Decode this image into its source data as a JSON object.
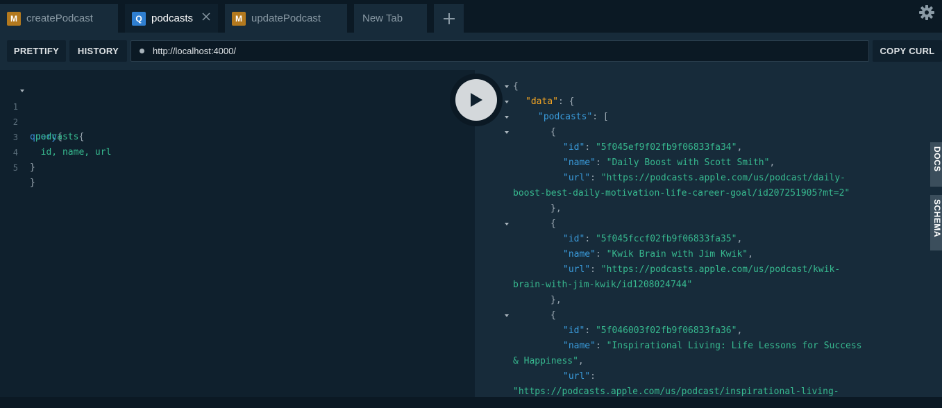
{
  "tabs": [
    {
      "badge": "M",
      "badge_color": "#b3791e",
      "label": "createPodcast"
    },
    {
      "badge": "Q",
      "badge_color": "#2f7fd1",
      "label": "podcasts",
      "active": true
    },
    {
      "badge": "M",
      "badge_color": "#b3791e",
      "label": "updatePodcast"
    },
    {
      "badge": "",
      "label": "New Tab"
    }
  ],
  "toolbar": {
    "prettify_label": "PRETTIFY",
    "history_label": "HISTORY",
    "url": "http://localhost:4000/",
    "copy_curl_label": "COPY CURL"
  },
  "editor": {
    "line_numbers": [
      "1",
      "2",
      "3",
      "4",
      "5"
    ],
    "lines": [
      {
        "kw": "query",
        "punct": "{"
      },
      {
        "field": " podcasts",
        "punct": "{"
      },
      {
        "field": "  id, name, url"
      },
      {
        "punct": "}"
      },
      {
        "punct": "}"
      }
    ]
  },
  "result": {
    "brace_open": "{",
    "data_key": "\"data\"",
    "data_sep": ": {",
    "podcasts_key": "\"podcasts\"",
    "podcasts_sep": ": [",
    "obj_open": "{",
    "obj_close": "},",
    "id_key": "\"id\"",
    "name_key": "\"name\"",
    "url_key": "\"url\"",
    "colon": ": ",
    "comma": ",",
    "colon_only": ":",
    "items": [
      {
        "id": "\"5f045ef9f02fb9f06833fa34\"",
        "name": "\"Daily Boost with Scott Smith\"",
        "url_part1": "\"https://podcasts.apple.com/us/podcast/daily-",
        "url_part2": "boost-best-daily-motivation-life-career-goal/id207251905?mt=2\""
      },
      {
        "id": "\"5f045fccf02fb9f06833fa35\"",
        "name": "\"Kwik Brain with Jim Kwik\"",
        "url_part1": "\"https://podcasts.apple.com/us/podcast/kwik-",
        "url_part2": "brain-with-jim-kwik/id1208024744\""
      },
      {
        "id": "\"5f046003f02fb9f06833fa36\"",
        "name_part1": "\"Inspirational Living: Life Lessons for Success",
        "name_part2": "& Happiness\"",
        "url_part1": "\"https://podcasts.apple.com/us/podcast/inspirational-living-"
      }
    ]
  },
  "side_tabs": {
    "docs": "DOCS",
    "schema": "SCHEMA"
  }
}
